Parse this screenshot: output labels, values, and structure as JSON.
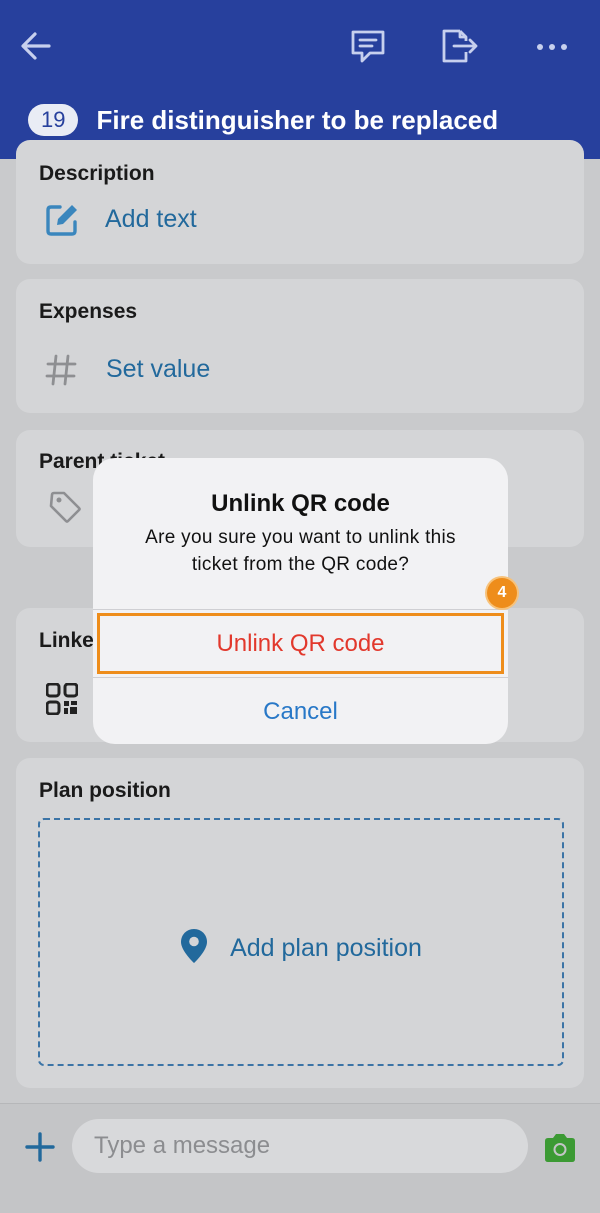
{
  "header": {
    "ticket_number": "19",
    "title": "Fire distinguisher to be replaced",
    "icons": [
      "back-arrow-icon",
      "comment-icon",
      "export-icon",
      "more-icon"
    ]
  },
  "cards": {
    "description": {
      "title": "Description",
      "value": "Add text",
      "icon": "edit-icon"
    },
    "expenses": {
      "title": "Expenses",
      "value": "Set value",
      "icon": "hash-icon"
    },
    "parent_ticket": {
      "title": "Parent ticket",
      "icon": "tag-icon"
    },
    "linked": {
      "title": "Linked QR code",
      "icon": "qr-code-icon"
    },
    "plan_position": {
      "title": "Plan position",
      "action": "Add plan position",
      "icon": "location-pin-icon"
    }
  },
  "dialog": {
    "title": "Unlink QR code",
    "message": "Are you sure you want to unlink this ticket from the QR code?",
    "confirm_label": "Unlink QR code",
    "cancel_label": "Cancel",
    "step_number": "4"
  },
  "composer": {
    "placeholder": "Type a message",
    "icons": [
      "plus-icon",
      "camera-icon"
    ]
  },
  "colors": {
    "header": "#27409d",
    "link": "#22699c",
    "destructive": "#e2382c",
    "highlight": "#ee8d1b",
    "camera": "#3c9a34"
  }
}
